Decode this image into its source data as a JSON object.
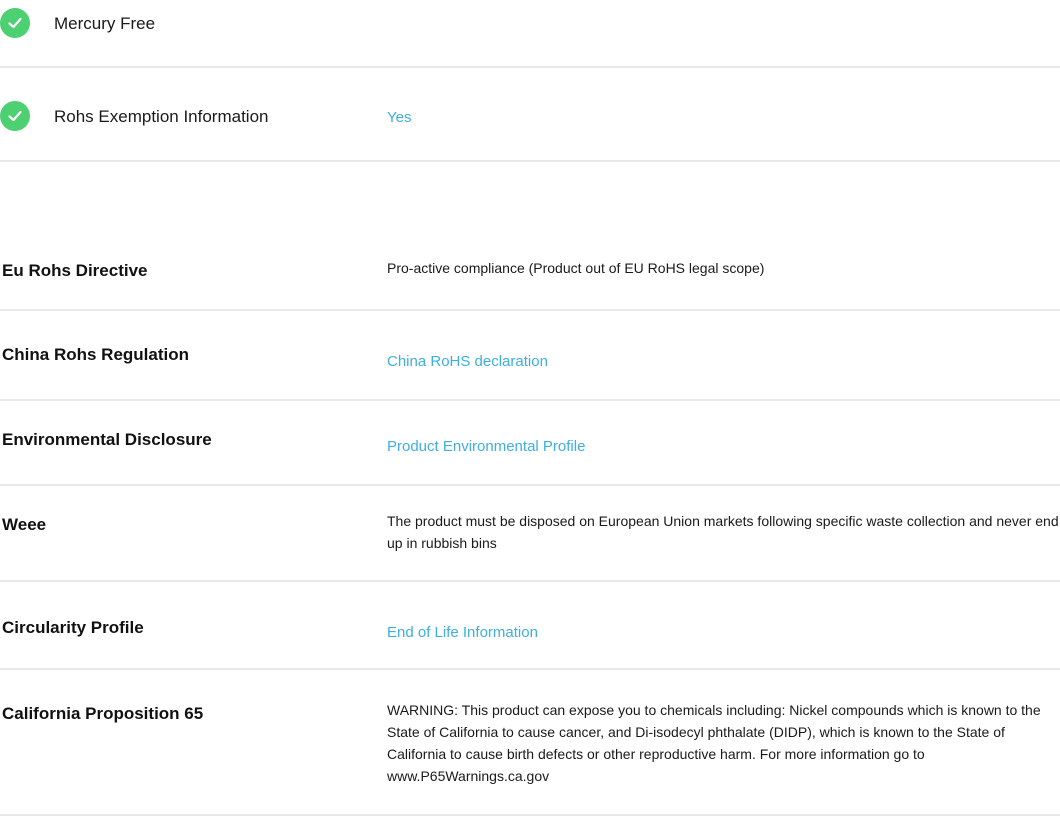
{
  "features": {
    "mercury_free": {
      "icon": "check-circle-icon",
      "label": "Mercury Free",
      "value": ""
    },
    "rohs_exemption": {
      "icon": "check-circle-icon",
      "label": "Rohs Exemption Information",
      "value": "Yes"
    }
  },
  "specs": {
    "eu_rohs": {
      "label": "Eu Rohs Directive",
      "value": "Pro-active compliance (Product out of EU RoHS legal scope)"
    },
    "china_rohs": {
      "label": "China Rohs Regulation",
      "link": "China RoHS declaration"
    },
    "environmental": {
      "label": "Environmental Disclosure",
      "link": "Product Environmental Profile"
    },
    "weee": {
      "label": "Weee",
      "value": "The product must be disposed on European Union markets following specific waste collection and never end up in rubbish bins"
    },
    "circularity": {
      "label": "Circularity Profile",
      "link": "End of Life Information"
    },
    "prop65": {
      "label": "California Proposition 65",
      "value": "WARNING: This product can expose you to chemicals including: Nickel compounds which is known to the State of California to cause cancer, and Di-isodecyl phthalate (DIDP), which is known to the State of California to cause birth defects or other reproductive harm. For more information go to www.P65Warnings.ca.gov"
    }
  },
  "colors": {
    "check_green": "#4cd072",
    "link_blue": "#3eaee0",
    "divider_gray": "#e9e9e9"
  }
}
